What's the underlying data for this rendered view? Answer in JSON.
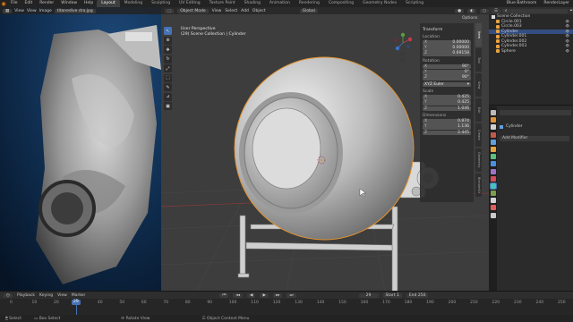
{
  "topbar": {
    "menus": [
      "File",
      "Edit",
      "Render",
      "Window",
      "Help"
    ],
    "workspaces": [
      "Layout",
      "Modeling",
      "Sculpting",
      "UV Editing",
      "Texture Paint",
      "Shading",
      "Animation",
      "Rendering",
      "Compositing",
      "Geometry Nodes",
      "Scripting"
    ],
    "active_workspace": "Layout",
    "scene": "Blue Bathroom",
    "view_layer": "RenderLayer"
  },
  "image_editor": {
    "menus": [
      "View",
      "View",
      "Image"
    ],
    "filename": "titanedive dra.jpg"
  },
  "viewport": {
    "mode": "Object Mode",
    "menus": [
      "View",
      "Select",
      "Add",
      "Object"
    ],
    "orientation": "Global",
    "perspective": "User Perspective",
    "collection": "(29) Scene Collection | Cylinder",
    "options": "Options"
  },
  "npanel": {
    "transform_header": "Transform",
    "location_label": "Location",
    "location": [
      {
        "k": "X",
        "v": "0.00000"
      },
      {
        "k": "Y",
        "v": "0.00000"
      },
      {
        "k": "Z",
        "v": "0.69158"
      }
    ],
    "rotation_label": "Rotation",
    "rotation": [
      {
        "k": "X",
        "v": "90°"
      },
      {
        "k": "Y",
        "v": "0°"
      },
      {
        "k": "Z",
        "v": "90°"
      }
    ],
    "mode_value": "XYZ Euler",
    "scale_label": "Scale",
    "scale": [
      {
        "k": "X",
        "v": "0.425"
      },
      {
        "k": "Y",
        "v": "0.425"
      },
      {
        "k": "Z",
        "v": "1.046"
      }
    ],
    "dimensions_label": "Dimensions",
    "dimensions": [
      {
        "k": "X",
        "v": "0.874"
      },
      {
        "k": "Y",
        "v": "1.136"
      },
      {
        "k": "Z",
        "v": "2.445"
      }
    ],
    "tabs": [
      "Item",
      "Tool",
      "View",
      "Edit",
      "Create",
      "Geometry",
      "BlenderKit"
    ]
  },
  "outliner": {
    "root": "Scene Collection",
    "items": [
      "Circle.001",
      "Circle.003",
      "Cylinder",
      "Cylinder.001",
      "Cylinder.002",
      "Cylinder.003",
      "Sphere"
    ],
    "selected_index": 2
  },
  "properties": {
    "object_name": "Cylinder",
    "add_modifier": "Add Modifier",
    "tab_colors": [
      "#bbbbbb",
      "#e0943a",
      "#d0d0d0",
      "#c25a4a",
      "#5fa0dd",
      "#e8a341",
      "#5ac27d",
      "#4b8fe0",
      "#9d74c9",
      "#d24e5c",
      "#47c4b9",
      "#7aa04d",
      "#d3d3d3",
      "#e05e5e",
      "#c9c9c9"
    ]
  },
  "timeline": {
    "menus": [
      "Playback",
      "Keying",
      "View",
      "Marker"
    ],
    "current_frame": "29",
    "start_label": "Start",
    "start": "1",
    "end_label": "End",
    "end": "250",
    "ticks": [
      "0",
      "10",
      "20",
      "30",
      "40",
      "50",
      "60",
      "70",
      "80",
      "90",
      "100",
      "110",
      "120",
      "130",
      "140",
      "150",
      "160",
      "170",
      "180",
      "190",
      "200",
      "210",
      "220",
      "230",
      "240",
      "250"
    ]
  },
  "statusbar": {
    "items": [
      "Select",
      "Box Select",
      "Rotate View",
      "Object Context Menu"
    ]
  },
  "colors": {
    "accent": "#4772b3",
    "orange": "#e87d0d",
    "outline": "#e0932f"
  }
}
